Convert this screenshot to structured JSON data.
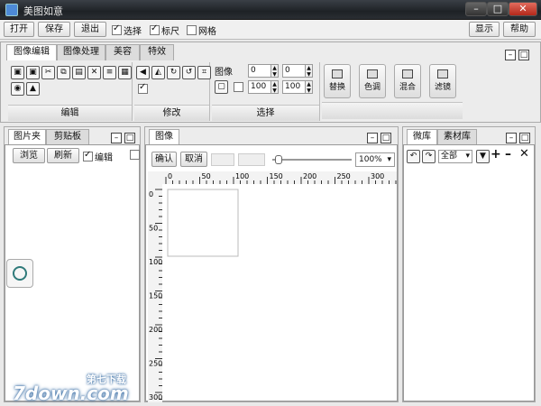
{
  "window": {
    "title": "美图如意",
    "controls": [
      "–",
      "□",
      "✕"
    ]
  },
  "menubar": {
    "open": "打开",
    "save": "保存",
    "exit": "退出",
    "select": "选择",
    "ruler": "标尺",
    "grid": "网格",
    "display": "显示",
    "help": "帮助"
  },
  "toolbox": {
    "tabs": [
      "图像编辑",
      "图像处理",
      "美容",
      "特效"
    ],
    "groups": {
      "edit": "编辑",
      "modify": "修改",
      "select": "选择"
    },
    "image_label": "图像",
    "spin_values": [
      "0",
      "0",
      "100",
      "100"
    ],
    "big_buttons": [
      "替换",
      "色调",
      "混合",
      "滤镜"
    ]
  },
  "left_panel": {
    "tabs": [
      "图片夹",
      "剪贴板"
    ],
    "browse": "浏览",
    "refresh": "刷新",
    "edit": "编辑"
  },
  "center_panel": {
    "tab": "图像",
    "confirm": "确认",
    "cancel": "取消",
    "zoom": "100%",
    "hruler_labels": [
      "0",
      "50",
      "100",
      "150",
      "200",
      "250",
      "300"
    ],
    "vruler_labels": [
      "0",
      "50",
      "100",
      "150",
      "200",
      "250",
      "300"
    ]
  },
  "right_panel": {
    "tabs": [
      "微库",
      "素材库"
    ],
    "filter": "全部"
  },
  "watermark": {
    "cn": "第七下载",
    "en": "7down.com"
  }
}
